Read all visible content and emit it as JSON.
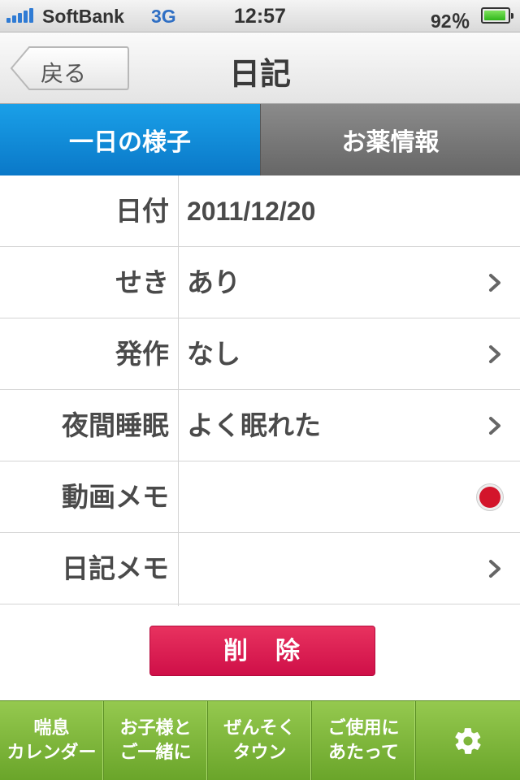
{
  "status": {
    "carrier": "SoftBank",
    "network": "3G",
    "time": "12:57",
    "battery_pct": "92％",
    "battery_level": 0.92
  },
  "nav": {
    "back_label": "戻る",
    "title": "日記"
  },
  "tabs": [
    {
      "label": "一日の様子",
      "active": true
    },
    {
      "label": "お薬情報",
      "active": false
    }
  ],
  "rows": [
    {
      "label": "日付",
      "value": "2011/12/20",
      "accessory": "none"
    },
    {
      "label": "せき",
      "value": "あり",
      "accessory": "chevron-right-icon"
    },
    {
      "label": "発作",
      "value": "なし",
      "accessory": "chevron-right-icon"
    },
    {
      "label": "夜間睡眠",
      "value": "よく眠れた",
      "accessory": "chevron-right-icon"
    },
    {
      "label": "動画メモ",
      "value": "",
      "accessory": "record-icon"
    },
    {
      "label": "日記メモ",
      "value": "",
      "accessory": "chevron-right-icon"
    }
  ],
  "delete_label": "削　除",
  "toolbar": [
    {
      "line1": "喘息",
      "line2": "カレンダー"
    },
    {
      "line1": "お子様と",
      "line2": "ご一緒に"
    },
    {
      "line1": "ぜんそく",
      "line2": "タウン"
    },
    {
      "line1": "ご使用に",
      "line2": "あたって"
    },
    {
      "icon": "gear-icon"
    }
  ],
  "colors": {
    "tab_active": "#0a88d8",
    "delete": "#d8174f",
    "toolbar": "#7fb83c",
    "record": "#d3152b"
  }
}
